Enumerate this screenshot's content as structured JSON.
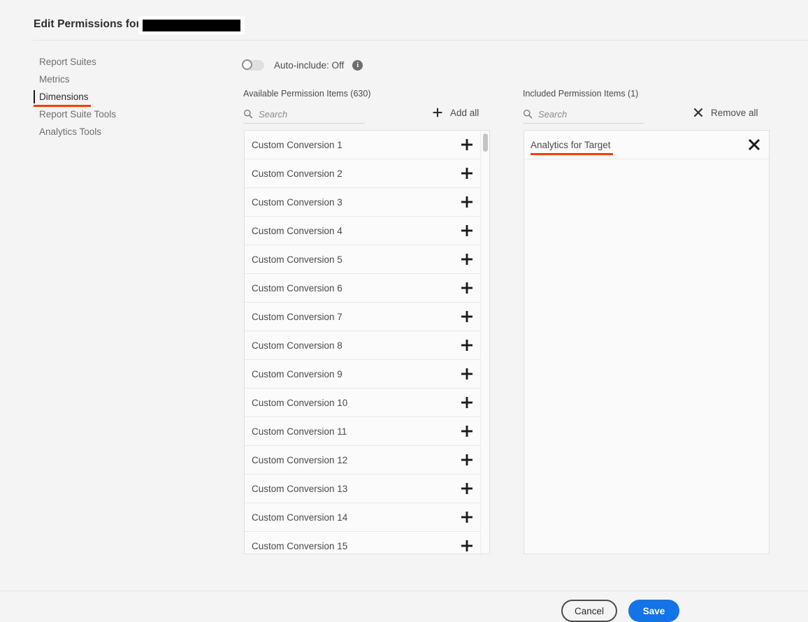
{
  "header": {
    "title": "Edit Permissions for",
    "redacted": true
  },
  "sidebar": {
    "items": [
      {
        "label": "Report Suites",
        "selected": false
      },
      {
        "label": "Metrics",
        "selected": false
      },
      {
        "label": "Dimensions",
        "selected": true
      },
      {
        "label": "Report Suite Tools",
        "selected": false
      },
      {
        "label": "Analytics Tools",
        "selected": false
      }
    ]
  },
  "auto_include": {
    "label": "Auto-include: Off",
    "state": "Off",
    "info_icon": "info-icon"
  },
  "available": {
    "heading": "Available Permission Items (630)",
    "count": 630,
    "search_placeholder": "Search",
    "search_value": "",
    "add_all_label": "Add all",
    "add_all_icon": "plus-icon",
    "items": [
      "Custom Conversion 1",
      "Custom Conversion 2",
      "Custom Conversion 3",
      "Custom Conversion 4",
      "Custom Conversion 5",
      "Custom Conversion 6",
      "Custom Conversion 7",
      "Custom Conversion 8",
      "Custom Conversion 9",
      "Custom Conversion 10",
      "Custom Conversion 11",
      "Custom Conversion 12",
      "Custom Conversion 13",
      "Custom Conversion 14",
      "Custom Conversion 15"
    ]
  },
  "included": {
    "heading": "Included Permission Items (1)",
    "count": 1,
    "search_placeholder": "Search",
    "search_value": "",
    "remove_all_label": "Remove all",
    "remove_all_icon": "close-icon",
    "items": [
      {
        "label": "Analytics for Target",
        "annotated": true
      }
    ]
  },
  "footer": {
    "cancel_label": "Cancel",
    "save_label": "Save"
  },
  "colors": {
    "accent_blue": "#1473e6",
    "annotation_red": "#f93d00",
    "page_background": "#f4f4f4",
    "text": "#4b4b4b"
  }
}
